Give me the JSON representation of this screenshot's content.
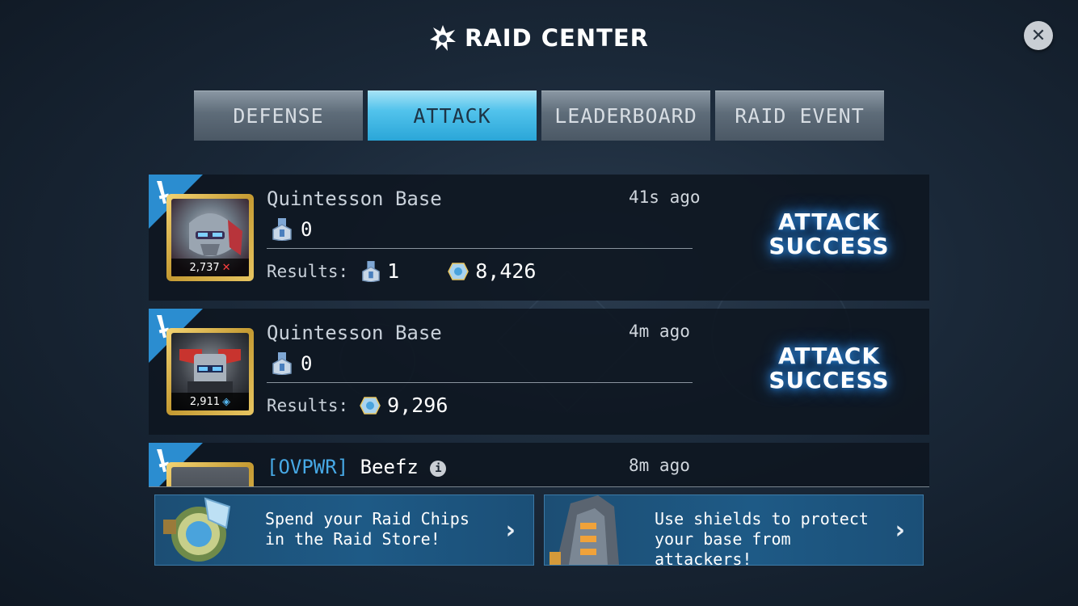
{
  "header": {
    "title": "RAID CENTER"
  },
  "close": {
    "label": "✕"
  },
  "tabs": [
    {
      "label": "DEFENSE",
      "active": false
    },
    {
      "label": "ATTACK",
      "active": true
    },
    {
      "label": "LEADERBOARD",
      "active": false
    },
    {
      "label": "RAID EVENT",
      "active": false
    }
  ],
  "raids": [
    {
      "name": "Quintesson Base",
      "time": "41s ago",
      "medals": "0",
      "portrait_score": "2,737",
      "results_label": "Results:",
      "result_medals": "1",
      "result_chips": "8,426",
      "outcome_line1": "ATTACK",
      "outcome_line2": "SUCCESS"
    },
    {
      "name": "Quintesson Base",
      "time": "4m ago",
      "medals": "0",
      "portrait_score": "2,911",
      "results_label": "Results:",
      "result_chips": "9,296",
      "outcome_line1": "ATTACK",
      "outcome_line2": "SUCCESS"
    },
    {
      "tag": "[OVPWR]",
      "name": "Beefz",
      "time": "8m ago"
    }
  ],
  "banners": [
    {
      "text": "Spend your Raid Chips in the Raid Store!",
      "arrow": "›"
    },
    {
      "text": "Use shields to protect your base from attackers!",
      "arrow": "›"
    }
  ],
  "colors": {
    "accent": "#2b8dd0",
    "active_tab": "#52c3ec",
    "banner": "#1e5a86",
    "portrait_frame": "#d4ab45"
  }
}
